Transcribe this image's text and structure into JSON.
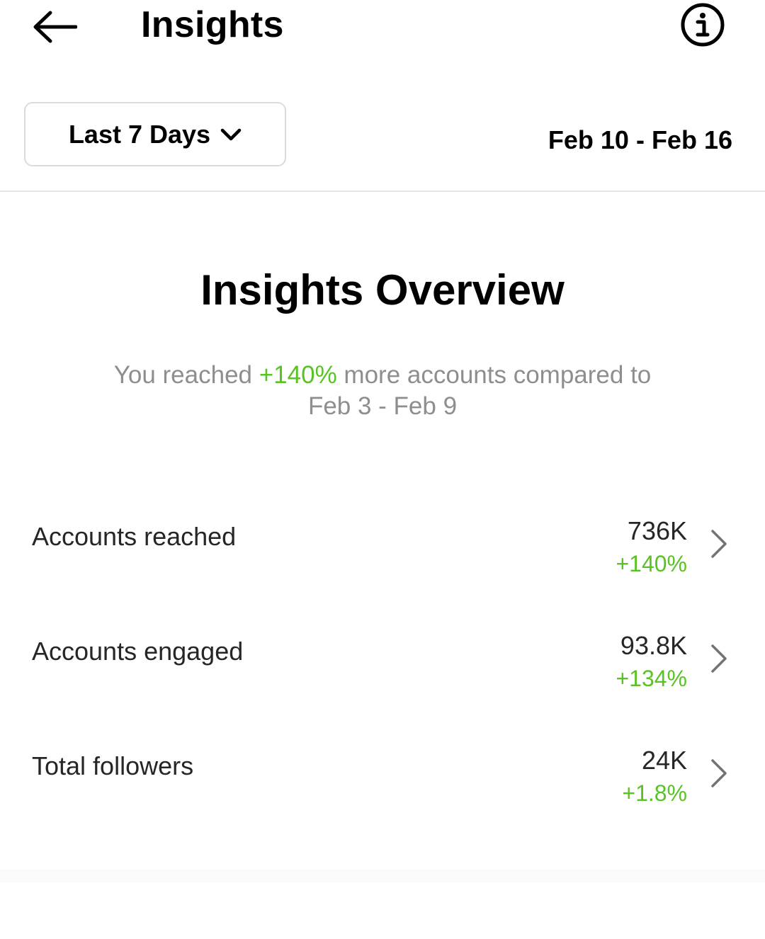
{
  "header": {
    "title": "Insights",
    "back_icon": "arrow-left-icon",
    "info_icon": "info-circle-icon"
  },
  "filter": {
    "range_label": "Last 7 Days",
    "date_range": "Feb 10 - Feb 16"
  },
  "overview": {
    "title": "Insights Overview",
    "summary_prefix": "You reached ",
    "summary_highlight": "+140%",
    "summary_suffix": " more accounts compared to",
    "summary_compare_range": "Feb 3 - Feb 9"
  },
  "metrics": [
    {
      "label": "Accounts reached",
      "value": "736K",
      "change": "+140%"
    },
    {
      "label": "Accounts engaged",
      "value": "93.8K",
      "change": "+134%"
    },
    {
      "label": "Total followers",
      "value": "24K",
      "change": "+1.8%"
    }
  ],
  "colors": {
    "positive": "#58c322",
    "muted_text": "#8e8e8e",
    "border": "#dbdbdb"
  }
}
